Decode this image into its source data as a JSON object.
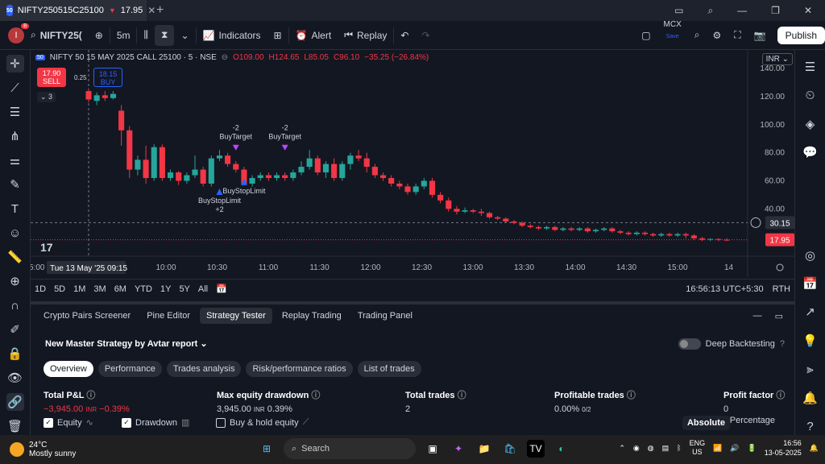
{
  "tab": {
    "title": "NIFTY250515C25100",
    "price": "17.95",
    "direction": "▼"
  },
  "toolbar": {
    "symbol": "NIFTY25(",
    "interval": "5m",
    "indicators_label": "Indicators",
    "alert_label": "Alert",
    "replay_label": "Replay",
    "exchange": "MCX",
    "exchange_save": "Save",
    "publish_label": "Publish",
    "notification_count": "8",
    "avatar_initial": "I"
  },
  "legend": {
    "title": "NIFTY 50 15 MAY 2025 CALL 25100 · 5 · NSE",
    "o": "O109.00",
    "h": "H124.65",
    "l": "L85.05",
    "c": "C96.10",
    "chg": "−35.25 (−26.84%)",
    "currency": "INR"
  },
  "trade_buttons": {
    "sell_price": "17.90",
    "sell_label": "SELL",
    "spread": "0.25",
    "buy_price": "18.15",
    "buy_label": "BUY",
    "qty": "3"
  },
  "chart_data": {
    "type": "candlestick",
    "title": "NIFTY 50 15 MAY 2025 CALL 25100 · 5 · NSE",
    "y_ticks": [
      140,
      120,
      100,
      80,
      60,
      40
    ],
    "ylim": [
      12,
      143
    ],
    "x_ticks": [
      "10:00",
      "10:30",
      "11:00",
      "11:30",
      "12:00",
      "12:30",
      "13:00",
      "13:30",
      "14:00",
      "14:30",
      "15:00",
      "14"
    ],
    "x_left_partial": "5:00",
    "crosshair_time": "Tue 13 May '25",
    "crosshair_time2": "09:15",
    "crosshair_price": "30.15",
    "last_price": "17.95",
    "candles": [
      [
        124,
        118,
        126,
        116
      ],
      [
        117,
        121,
        123,
        114
      ],
      [
        121,
        119,
        124,
        117
      ],
      [
        119,
        122,
        124,
        118
      ],
      [
        110,
        96,
        114,
        85
      ],
      [
        96,
        68,
        99,
        62
      ],
      [
        68,
        75,
        78,
        64
      ],
      [
        75,
        62,
        85,
        58
      ],
      [
        62,
        84,
        86,
        60
      ],
      [
        84,
        62,
        86,
        60
      ],
      [
        62,
        66,
        68,
        60
      ],
      [
        66,
        60,
        67,
        57
      ],
      [
        60,
        64,
        66,
        58
      ],
      [
        64,
        68,
        78,
        62
      ],
      [
        68,
        58,
        70,
        56
      ],
      [
        58,
        76,
        78,
        56
      ],
      [
        76,
        78,
        82,
        74
      ],
      [
        78,
        72,
        80,
        70
      ],
      [
        72,
        68,
        74,
        66
      ],
      [
        68,
        58,
        70,
        57
      ],
      [
        58,
        62,
        64,
        56
      ],
      [
        62,
        64,
        66,
        60
      ],
      [
        64,
        62,
        66,
        60
      ],
      [
        62,
        64,
        66,
        60
      ],
      [
        64,
        62,
        66,
        60
      ],
      [
        62,
        66,
        68,
        60
      ],
      [
        66,
        70,
        74,
        64
      ],
      [
        70,
        76,
        82,
        68
      ],
      [
        76,
        66,
        78,
        64
      ],
      [
        66,
        72,
        74,
        62
      ],
      [
        72,
        62,
        76,
        60
      ],
      [
        62,
        72,
        74,
        60
      ],
      [
        72,
        78,
        80,
        68
      ],
      [
        78,
        76,
        82,
        74
      ],
      [
        76,
        70,
        80,
        66
      ],
      [
        70,
        64,
        72,
        62
      ],
      [
        64,
        62,
        66,
        60
      ],
      [
        62,
        58,
        64,
        56
      ],
      [
        58,
        56,
        60,
        54
      ],
      [
        56,
        52,
        58,
        50
      ],
      [
        52,
        56,
        58,
        50
      ],
      [
        56,
        60,
        62,
        54
      ],
      [
        60,
        50,
        62,
        48
      ],
      [
        50,
        46,
        52,
        44
      ],
      [
        46,
        40,
        48,
        38
      ],
      [
        40,
        38,
        42,
        36
      ],
      [
        38,
        39,
        41,
        37
      ],
      [
        39,
        38,
        40,
        37
      ],
      [
        38,
        37,
        40,
        35
      ],
      [
        37,
        34,
        38,
        33
      ],
      [
        34,
        33,
        35,
        32
      ],
      [
        33,
        31,
        34,
        30
      ],
      [
        31,
        30,
        32,
        29
      ],
      [
        30,
        28,
        31,
        27
      ],
      [
        28,
        27,
        29,
        26
      ],
      [
        27,
        26,
        28,
        25
      ],
      [
        26,
        27,
        28,
        25
      ],
      [
        27,
        25,
        28,
        24
      ],
      [
        25,
        26,
        27,
        24
      ],
      [
        26,
        25,
        27,
        24
      ],
      [
        25,
        26,
        27,
        24
      ],
      [
        26,
        24,
        27,
        23
      ],
      [
        24,
        25,
        26,
        23
      ],
      [
        25,
        26,
        27,
        24
      ],
      [
        26,
        24,
        27,
        23
      ],
      [
        24,
        23,
        25,
        22
      ],
      [
        23,
        22,
        24,
        21
      ],
      [
        22,
        23,
        24,
        21
      ],
      [
        23,
        22,
        24,
        21
      ],
      [
        22,
        21,
        23,
        20
      ],
      [
        21,
        22,
        23,
        20
      ],
      [
        22,
        21,
        23,
        20
      ],
      [
        21,
        22,
        23,
        20
      ],
      [
        22,
        21,
        23,
        19
      ],
      [
        21,
        19,
        22,
        18
      ],
      [
        19,
        18,
        20,
        17
      ],
      [
        18,
        18.5,
        19,
        17
      ],
      [
        18.5,
        18,
        19,
        17
      ],
      [
        18,
        17.95,
        19,
        17
      ]
    ],
    "annotations": [
      {
        "text": "-2",
        "text2": "BuyTarget",
        "kind": "sell"
      },
      {
        "text": "-2",
        "text2": "BuyTarget",
        "kind": "sell"
      },
      {
        "text": "BuyStopLimit",
        "text2": "",
        "kind": "buy"
      },
      {
        "text": "BuyStopLimit",
        "text2": "+2",
        "kind": "buy"
      }
    ]
  },
  "ranges": [
    "1D",
    "5D",
    "1M",
    "3M",
    "6M",
    "YTD",
    "1Y",
    "5Y",
    "All"
  ],
  "clock": {
    "time": "16:56:13 UTC+5:30",
    "rth": "RTH"
  },
  "panel": {
    "tabs": [
      "Crypto Pairs Screener",
      "Pine Editor",
      "Strategy Tester",
      "Replay Trading",
      "Trading Panel"
    ],
    "strategy": "New Master Strategy by Avtar report",
    "deep_label": "Deep Backtesting",
    "subtabs": [
      "Overview",
      "Performance",
      "Trades analysis",
      "Risk/performance ratios",
      "List of trades"
    ],
    "metrics": [
      {
        "label": "Total P&L",
        "value": "−3,945.00",
        "unit": "INR",
        "extra": "−0.39%"
      },
      {
        "label": "Max equity drawdown",
        "value": "3,945.00",
        "unit": "INR",
        "extra": "0.39%"
      },
      {
        "label": "Total trades",
        "value": "2",
        "unit": "",
        "extra": ""
      },
      {
        "label": "Profitable trades",
        "value": "0.00%",
        "unit": "",
        "extra": "0/2"
      },
      {
        "label": "Profit factor",
        "value": "0",
        "unit": "",
        "extra": ""
      }
    ],
    "checks": [
      {
        "label": "Equity",
        "checked": true
      },
      {
        "label": "Drawdown",
        "checked": true
      },
      {
        "label": "Buy & hold equity",
        "checked": false
      }
    ],
    "absolute_label": "Absolute",
    "percentage_label": "Percentage"
  },
  "taskbar": {
    "temp": "24°C",
    "weather": "Mostly sunny",
    "search": "Search",
    "lang": "ENG",
    "region": "US",
    "time": "16:56",
    "date": "13-05-2025"
  },
  "colors": {
    "up": "#26a69a",
    "down": "#f23645",
    "bg": "#131722"
  }
}
